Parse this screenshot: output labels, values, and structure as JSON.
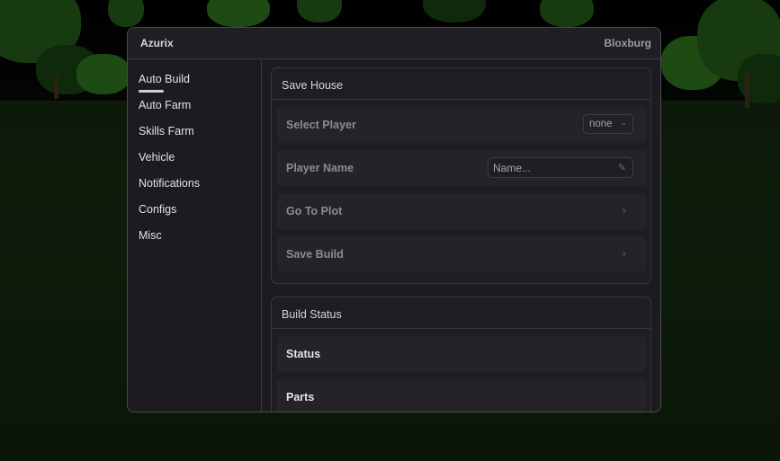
{
  "window": {
    "title": "Azurix",
    "game": "Bloxburg"
  },
  "sidebar": {
    "items": [
      {
        "label": "Auto Build",
        "active": true
      },
      {
        "label": "Auto Farm"
      },
      {
        "label": "Skills Farm"
      },
      {
        "label": "Vehicle"
      },
      {
        "label": "Notifications"
      },
      {
        "label": "Configs"
      },
      {
        "label": "Misc"
      }
    ]
  },
  "save_house": {
    "title": "Save House",
    "select_player": {
      "label": "Select Player",
      "value": "none"
    },
    "player_name": {
      "label": "Player Name",
      "placeholder": "Name..."
    },
    "go_to_plot": {
      "label": "Go To Plot"
    },
    "save_build": {
      "label": "Save Build"
    }
  },
  "build_status": {
    "title": "Build Status",
    "status": {
      "label": "Status"
    },
    "parts": {
      "label": "Parts"
    }
  },
  "icons": {
    "dropdown": "chevron-down-icon",
    "edit": "pencil-icon",
    "action": "chevron-right-icon"
  },
  "colors": {
    "window_bg": "#1c1b20",
    "row_bg": "#242328",
    "text_primary": "#e2e1e7",
    "text_muted": "#8c8b92"
  }
}
